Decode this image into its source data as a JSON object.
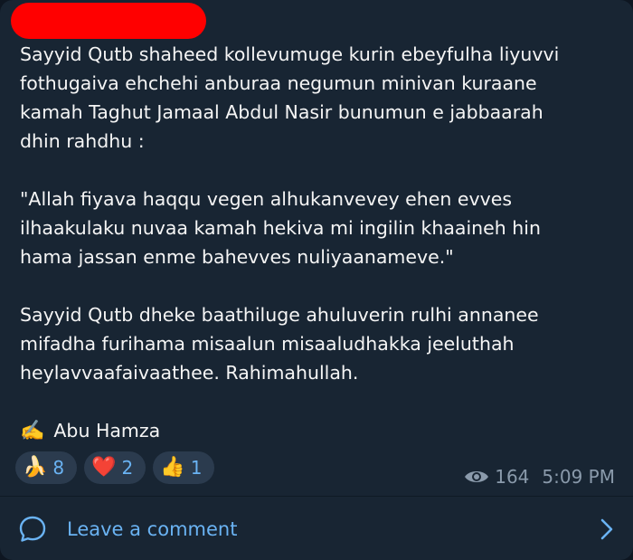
{
  "post": {
    "paragraphs": [
      "Sayyid Qutb shaheed kollevumuge kurin ebeyfulha liyuvvi\nfothugaiva ehchehi anburaa negumun minivan kuraane\nkamah Taghut Jamaal Abdul Nasir bunumun e jabbaarah\ndhin rahdhu :",
      "\"Allah fiyava haqqu vegen alhukanvevey ehen evves\nilhaakulaku nuvaa kamah hekiva mi ingilin khaaineh hin\nhama jassan enme bahevves nuliyaanameve.\"",
      "Sayyid Qutb dheke baathiluge ahuluverin rulhi annanee\nmifadha furihama misaalun misaaludhakka jeeluthah\nheylavvaafaivaathee. Rahimahullah."
    ],
    "signature": {
      "icon": "✍️",
      "icon_name": "writing-hand-icon",
      "text": "Abu Hamza"
    },
    "reactions": [
      {
        "emoji": "🍌",
        "icon_name": "banana-icon",
        "count": "8"
      },
      {
        "emoji": "❤️",
        "icon_name": "heart-icon",
        "count": "2"
      },
      {
        "emoji": "👍",
        "icon_name": "thumbs-up-icon",
        "count": "1"
      }
    ],
    "views": "164",
    "time": "5:09 PM"
  },
  "comment_bar": {
    "label": "Leave a comment",
    "icon_name": "comment-bubble-icon"
  },
  "colors": {
    "background": "#182533",
    "text": "#f5f5f5",
    "accent": "#6ab3f3",
    "meta": "#8a9aab",
    "reaction_bg": "#2b3b4e",
    "redaction": "#ff0000"
  }
}
